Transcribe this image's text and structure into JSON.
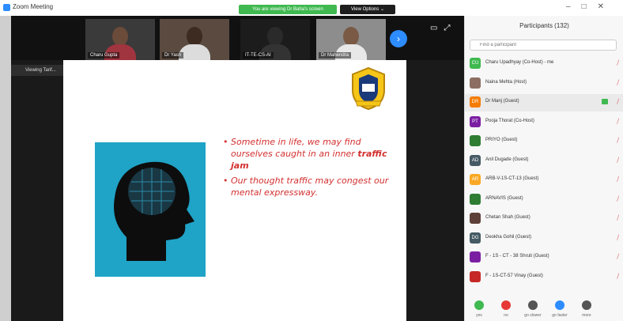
{
  "window": {
    "title": "Zoom Meeting",
    "share_banner": "You are viewing Dr Baha's screen",
    "view_options": "View Options ⌄"
  },
  "video_strip": {
    "tiles": [
      {
        "name": "Charu Gupta"
      },
      {
        "name": "Dr Yash"
      },
      {
        "name": "IT-TE-CS-AI"
      },
      {
        "name": "Dr Mahendra"
      }
    ]
  },
  "meeting": {
    "viewing_label": "Viewing Tarif..."
  },
  "slide": {
    "bullets": [
      {
        "text": "Sometime in life, we may find ourselves caught in an inner ",
        "bold": "traffic jam"
      },
      {
        "text": "Our thought traffic may congest our mental expressway.",
        "bold": ""
      }
    ]
  },
  "participants": {
    "title": "Participants (132)",
    "search_placeholder": "Find a participant",
    "rows": [
      {
        "initials": "CU",
        "name": "Charu Upadhyay (Co-Host) - me",
        "color": "#3fb950"
      },
      {
        "initials": "",
        "name": "Naina Mehta (Host)",
        "color": "#8d6e63"
      },
      {
        "initials": "DR",
        "name": "Dr Manj (Guest)",
        "color": "#f57c00"
      },
      {
        "initials": "PT",
        "name": "Pooja Thorat (Co-Host)",
        "color": "#7b1fa2"
      },
      {
        "initials": "",
        "name": "PRIYO (Guest)",
        "color": "#2e7d32"
      },
      {
        "initials": "AD",
        "name": "Anil Dugade (Guest)",
        "color": "#455a64"
      },
      {
        "initials": "AR",
        "name": "ARB-V-1S-CT-13 (Guest)",
        "color": "#f9a825"
      },
      {
        "initials": "",
        "name": "ARNAVIS (Guest)",
        "color": "#2e7d32"
      },
      {
        "initials": "",
        "name": "Chetan Shah (Guest)",
        "color": "#5d4037"
      },
      {
        "initials": "DG",
        "name": "Deokha Gohil (Guest)",
        "color": "#455a64"
      },
      {
        "initials": "",
        "name": "F - 1S - CT - 38 Shruti (Guest)",
        "color": "#7b1fa2"
      },
      {
        "initials": "",
        "name": "F - 1S-CT-57 Vinay (Guest)",
        "color": "#c62828"
      }
    ],
    "bottom_buttons": [
      "yes",
      "no",
      "go slower",
      "go faster",
      "more"
    ]
  }
}
